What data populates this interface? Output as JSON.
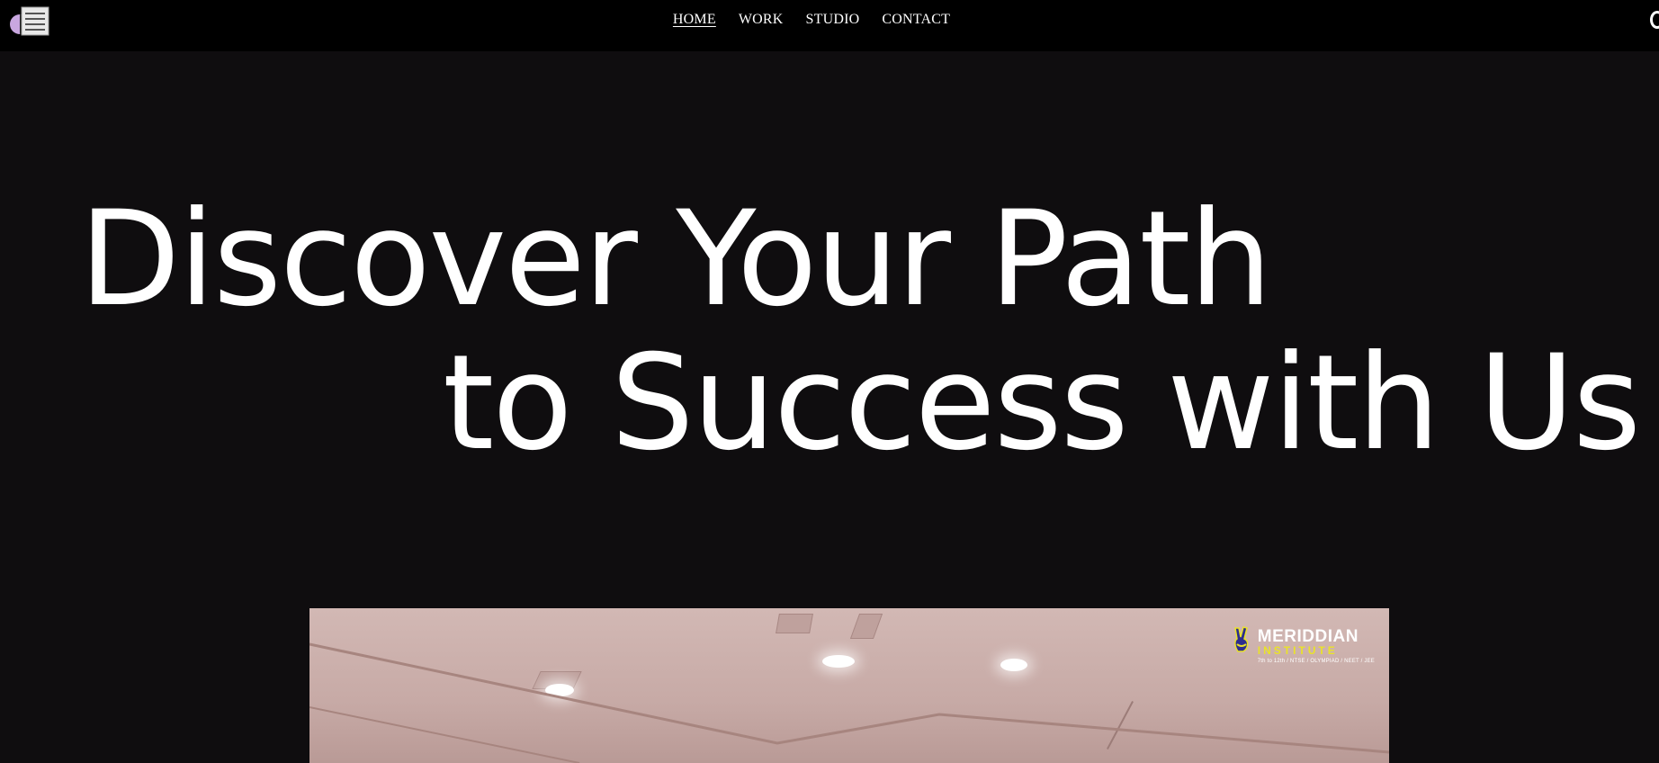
{
  "header": {
    "logo_icon": "split-circle-menu-logo-icon",
    "nav": [
      {
        "label": "HOME",
        "active": true
      },
      {
        "label": "WORK",
        "active": false
      },
      {
        "label": "STUDIO",
        "active": false
      },
      {
        "label": "CONTACT",
        "active": false
      }
    ]
  },
  "hero": {
    "headline_line1": "Discover Your Path",
    "headline_line2": "to Success with Us"
  },
  "media": {
    "brand_name": "MERIDDIAN",
    "brand_sub": "INSTITUTE",
    "brand_tagline": "7th to 12th / NTSE / OLYMPIAD / NEET / JEE"
  },
  "colors": {
    "background": "#0f0d0f",
    "topbar": "#000000",
    "text": "#ffffff",
    "brand_accent": "#e9e22a",
    "logo_accent": "#c9a7e0"
  }
}
